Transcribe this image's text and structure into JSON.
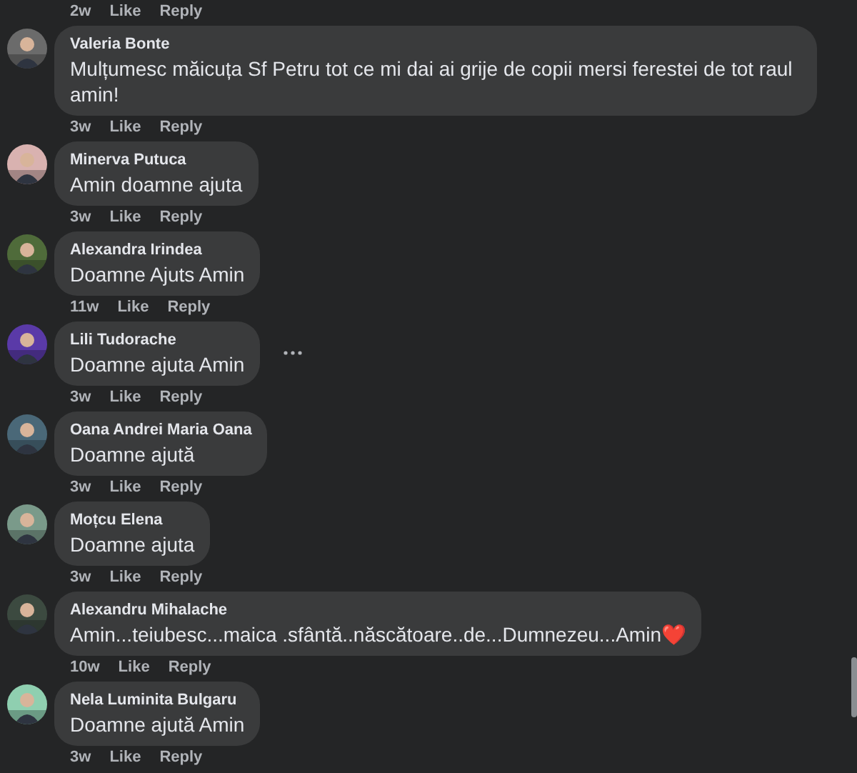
{
  "top_actions": {
    "time": "2w",
    "like": "Like",
    "reply": "Reply"
  },
  "comments": [
    {
      "author": "Valeria Bonte",
      "text": "Mulțumesc măicuța Sf Petru tot ce mi dai ai grije de copii mersi ferestei de tot raul amin!",
      "time": "3w",
      "like": "Like",
      "reply": "Reply",
      "more_options": false
    },
    {
      "author": "Minerva Putuca",
      "text": "Amin doamne ajuta",
      "time": "3w",
      "like": "Like",
      "reply": "Reply",
      "more_options": false
    },
    {
      "author": "Alexandra Irindea",
      "text": "Doamne Ajuts Amin",
      "time": "11w",
      "like": "Like",
      "reply": "Reply",
      "more_options": false
    },
    {
      "author": "Lili Tudorache",
      "text": "Doamne ajuta Amin",
      "time": "3w",
      "like": "Like",
      "reply": "Reply",
      "more_options": true
    },
    {
      "author": "Oana Andrei Maria Oana",
      "text": "Doamne ajută",
      "time": "3w",
      "like": "Like",
      "reply": "Reply",
      "more_options": false
    },
    {
      "author": "Moțcu Elena",
      "text": "Doamne ajuta",
      "time": "3w",
      "like": "Like",
      "reply": "Reply",
      "more_options": false
    },
    {
      "author": "Alexandru Mihalache",
      "text": "Amin...teiubesc...maica .sfântă..născătoare..de...Dumnezeu...Amin❤️",
      "time": "10w",
      "like": "Like",
      "reply": "Reply",
      "more_options": false
    },
    {
      "author": "Nela Luminita Bulgaru",
      "text": "Doamne ajută Amin",
      "time": "3w",
      "like": "Like",
      "reply": "Reply",
      "more_options": false
    }
  ]
}
